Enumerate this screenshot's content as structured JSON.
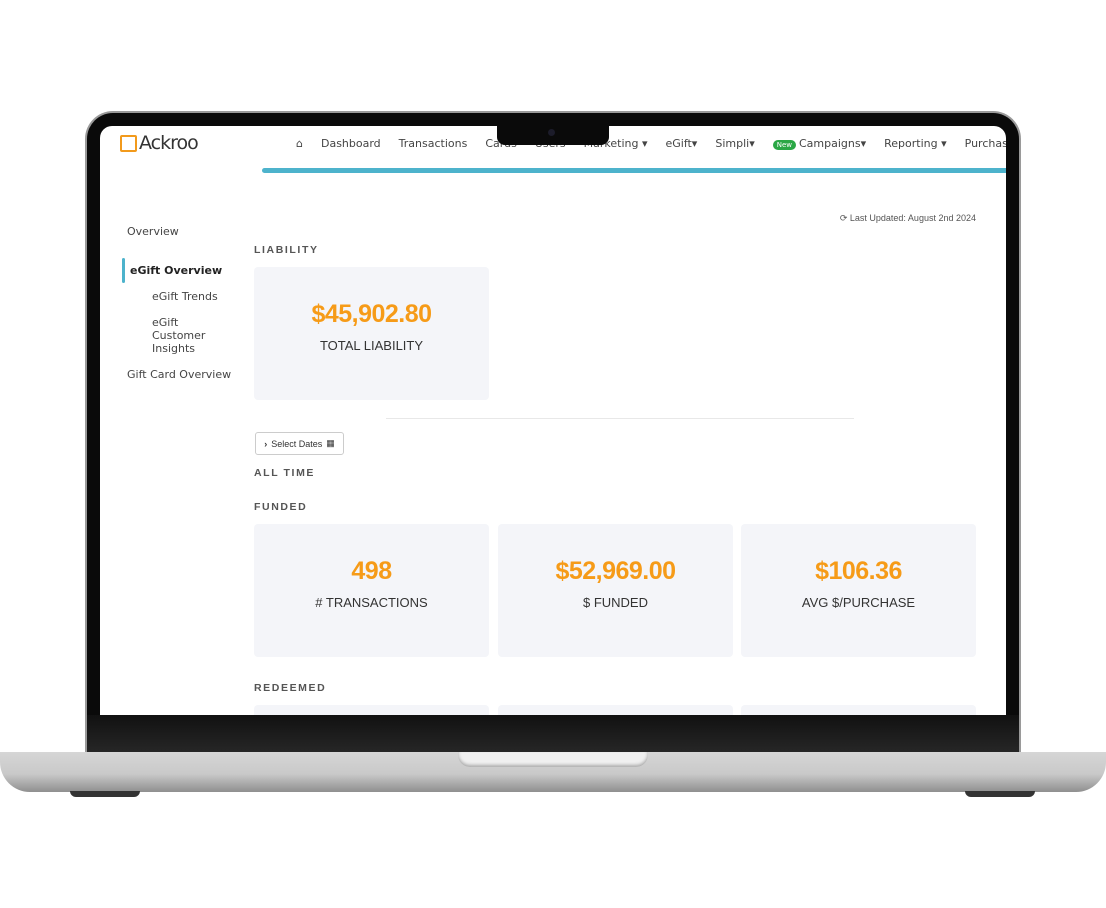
{
  "app": {
    "brand": "Ackroo",
    "accent": "#4db3cc",
    "value_color": "#f69b18"
  },
  "nav": {
    "items": [
      "Dashboard",
      "Transactions",
      "Cards",
      "Users",
      "Marketing ▾",
      "eGift▾",
      "Simpli▾",
      "Campaigns▾",
      "Reporting ▾",
      "Purchases ▾"
    ],
    "new_badge": "New"
  },
  "sidebar": {
    "overview": "Overview",
    "egift_overview": "eGift Overview",
    "egift_trends": "eGift Trends",
    "egift_insights": "eGift Customer Insights",
    "giftcard_overview": "Gift Card Overview"
  },
  "main": {
    "last_updated": "Last Updated: August 2nd 2024",
    "liability_heading": "LIABILITY",
    "liability": {
      "value": "$45,902.80",
      "label": "TOTAL LIABILITY"
    },
    "select_dates": "Select Dates",
    "all_time": "ALL TIME",
    "funded_heading": "FUNDED",
    "funded": [
      {
        "value": "498",
        "label": "# TRANSACTIONS"
      },
      {
        "value": "$52,969.00",
        "label": "$ FUNDED"
      },
      {
        "value": "$106.36",
        "label": "AVG $/PURCHASE"
      }
    ],
    "redeemed_heading": "REDEEMED"
  }
}
